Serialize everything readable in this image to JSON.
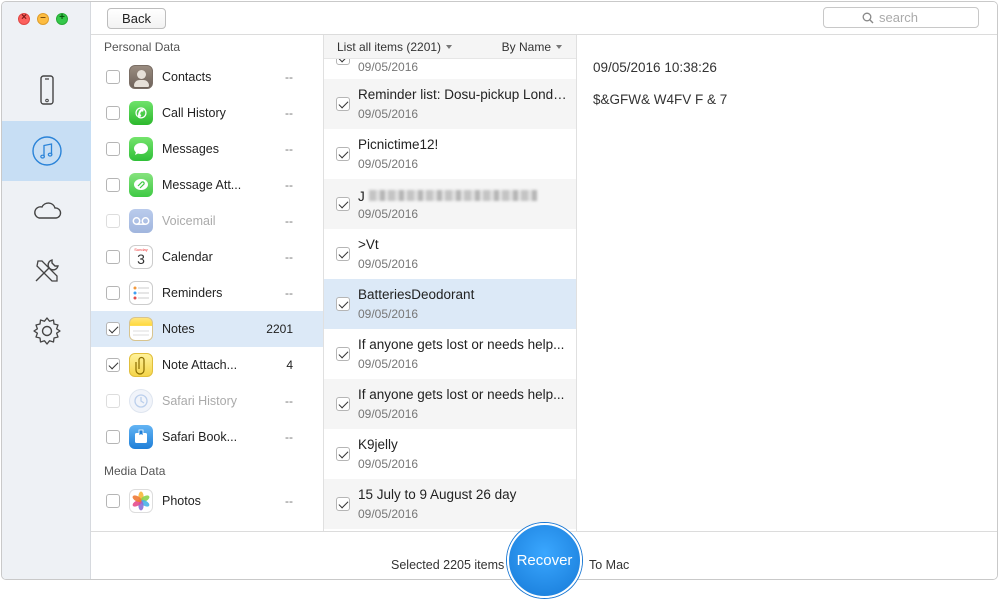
{
  "colors": {
    "accent": "#1a86e8",
    "selection": "#dce9f7",
    "rail_active": "#c7def4"
  },
  "toolbar": {
    "back_label": "Back",
    "search_placeholder": "search"
  },
  "rail": {
    "items": [
      "phone-icon",
      "music-note-icon",
      "cloud-icon",
      "tools-icon",
      "gear-icon"
    ],
    "active": "music-note-icon"
  },
  "categories": {
    "personal_heading": "Personal Data",
    "media_heading": "Media Data",
    "items": [
      {
        "label": "Contacts",
        "count": "--",
        "checked": false,
        "disabled": false
      },
      {
        "label": "Call History",
        "count": "--",
        "checked": false,
        "disabled": false
      },
      {
        "label": "Messages",
        "count": "--",
        "checked": false,
        "disabled": false
      },
      {
        "label": "Message Att...",
        "count": "--",
        "checked": false,
        "disabled": false
      },
      {
        "label": "Voicemail",
        "count": "--",
        "checked": false,
        "disabled": true
      },
      {
        "label": "Calendar",
        "count": "--",
        "checked": false,
        "disabled": false
      },
      {
        "label": "Reminders",
        "count": "--",
        "checked": false,
        "disabled": false
      },
      {
        "label": "Notes",
        "count": "2201",
        "checked": true,
        "disabled": false,
        "selected": true
      },
      {
        "label": "Note Attach...",
        "count": "4",
        "checked": true,
        "disabled": false
      },
      {
        "label": "Safari History",
        "count": "--",
        "checked": false,
        "disabled": true
      },
      {
        "label": "Safari Book...",
        "count": "--",
        "checked": false,
        "disabled": false
      }
    ],
    "media_items": [
      {
        "label": "Photos",
        "count": "--",
        "checked": false,
        "disabled": false
      }
    ],
    "calendar_day": "3",
    "calendar_weekday": "Sunday"
  },
  "list": {
    "filter_label": "List all items (2201)",
    "sort_label": "By Name",
    "partial_date": "09/05/2016",
    "rows": [
      {
        "title": "Reminder list: Dosu-pickup London...",
        "date": "09/05/2016",
        "checked": true
      },
      {
        "title": "Picnictime12!",
        "date": "09/05/2016",
        "checked": true
      },
      {
        "title": "J",
        "date": "09/05/2016",
        "checked": true,
        "blurred": true
      },
      {
        "title": ">Vt",
        "date": "09/05/2016",
        "checked": true
      },
      {
        "title": "BatteriesDeodorant",
        "date": "09/05/2016",
        "checked": true,
        "selected": true
      },
      {
        "title": "If anyone gets lost or needs help...",
        "date": "09/05/2016",
        "checked": true
      },
      {
        "title": "If anyone gets lost or needs help...",
        "date": "09/05/2016",
        "checked": true
      },
      {
        "title": "K9jelly",
        "date": "09/05/2016",
        "checked": true
      },
      {
        "title": "15 July to 9 August 26 day",
        "date": "09/05/2016",
        "checked": true
      }
    ]
  },
  "detail": {
    "date": "09/05/2016 10:38:26",
    "body": "$&GFW& W4FV F & 7"
  },
  "footer": {
    "selected_text": "Selected 2205 items",
    "recover_label": "Recover",
    "to_mac": "To Mac"
  }
}
